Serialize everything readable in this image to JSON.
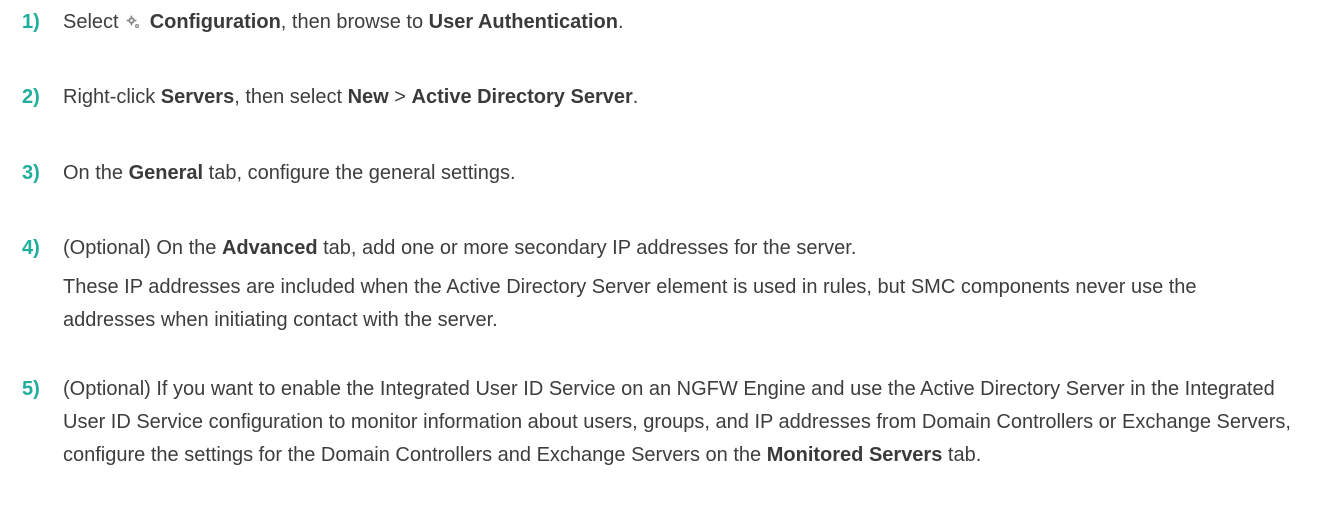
{
  "steps": [
    {
      "number": "1)",
      "segments": [
        {
          "text": "Select ",
          "bold": false
        },
        {
          "icon": "gear-icon"
        },
        {
          "text": " Configuration",
          "bold": true
        },
        {
          "text": ", then browse to ",
          "bold": false
        },
        {
          "text": "User Authentication",
          "bold": true
        },
        {
          "text": ".",
          "bold": false
        }
      ]
    },
    {
      "number": "2)",
      "segments": [
        {
          "text": "Right-click ",
          "bold": false
        },
        {
          "text": "Servers",
          "bold": true
        },
        {
          "text": ", then select ",
          "bold": false
        },
        {
          "text": "New",
          "bold": true
        },
        {
          "text": " > ",
          "bold": false
        },
        {
          "text": "Active Directory Server",
          "bold": true
        },
        {
          "text": ".",
          "bold": false
        }
      ]
    },
    {
      "number": "3)",
      "segments": [
        {
          "text": "On the ",
          "bold": false
        },
        {
          "text": "General",
          "bold": true
        },
        {
          "text": " tab, configure the general settings.",
          "bold": false
        }
      ]
    },
    {
      "number": "4)",
      "segments": [
        {
          "text": "(Optional) On the ",
          "bold": false
        },
        {
          "text": "Advanced",
          "bold": true
        },
        {
          "text": " tab, add one or more secondary IP addresses for the server.",
          "bold": false
        }
      ],
      "note": "These IP addresses are included when the Active Directory Server element is used in rules, but SMC components never use the addresses when initiating contact with the server."
    },
    {
      "number": "5)",
      "segments": [
        {
          "text": "(Optional) If you want to enable the Integrated User ID Service on an NGFW Engine and use the Active Directory Server in the Integrated User ID Service configuration to monitor information about users, groups, and IP addresses from Domain Controllers or Exchange Servers, configure the settings for the Domain Controllers and Exchange Servers on the ",
          "bold": false
        },
        {
          "text": "Monitored Servers",
          "bold": true
        },
        {
          "text": " tab.",
          "bold": false
        }
      ]
    }
  ]
}
